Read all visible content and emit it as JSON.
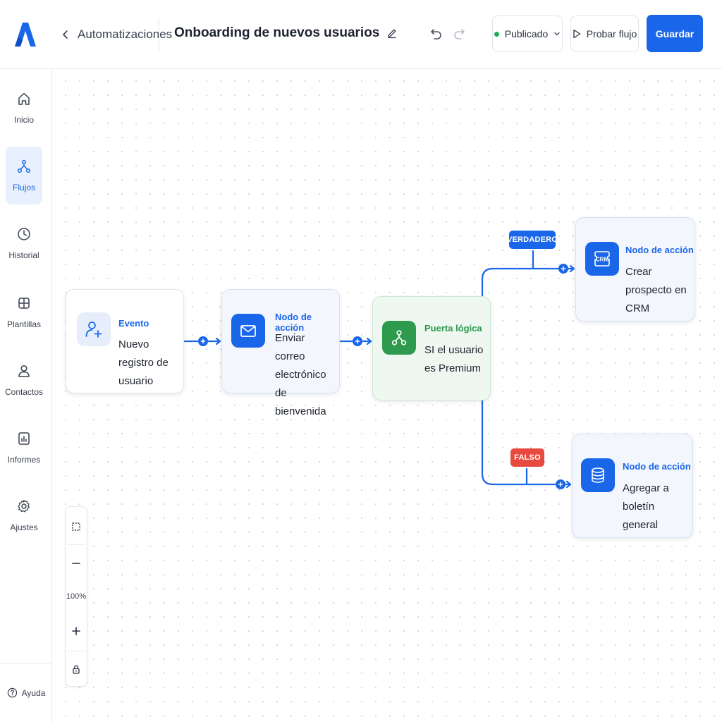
{
  "header": {
    "back_label": "Automatizaciones",
    "flow_title": "Onboarding de nuevos usuarios",
    "status_label": "Publicado",
    "test_label": "Probar flujo",
    "save_label": "Guardar"
  },
  "sidebar": {
    "items": [
      {
        "label": "Inicio",
        "icon": "home-icon"
      },
      {
        "label": "Flujos",
        "icon": "flows-icon",
        "active": true
      },
      {
        "label": "Historial",
        "icon": "clock-icon"
      },
      {
        "label": "Plantillas",
        "icon": "templates-icon"
      },
      {
        "label": "Contactos",
        "icon": "user-icon"
      },
      {
        "label": "Informes",
        "icon": "chart-icon"
      },
      {
        "label": "Ajustes",
        "icon": "gear-icon"
      }
    ],
    "help_label": "Ayuda"
  },
  "nodes": {
    "event": {
      "kind": "Evento",
      "text": "Nuevo registro de usuario",
      "icon": "user-plus-icon"
    },
    "email": {
      "kind": "Nodo de acción",
      "text": "Enviar correo electrónico de bienvenida",
      "icon": "mail-icon"
    },
    "logic": {
      "kind": "Puerta lógica",
      "text": "SI el usuario es Premium",
      "icon": "branch-icon"
    },
    "crm": {
      "kind": "Nodo de acción",
      "text": "Crear prospecto en CRM",
      "icon": "crm-icon",
      "icon_text": "CRM"
    },
    "newsletter": {
      "kind": "Nodo de acción",
      "text": "Agregar a boletín general",
      "icon": "database-icon"
    }
  },
  "branches": {
    "true_label": "VERDADERO",
    "false_label": "FALSO"
  },
  "zoom": {
    "level": "100%"
  },
  "colors": {
    "accent": "#1a66e8",
    "logic_green": "#2d9a4e",
    "false_red": "#e94a3f",
    "status_green": "#1faa5a"
  }
}
